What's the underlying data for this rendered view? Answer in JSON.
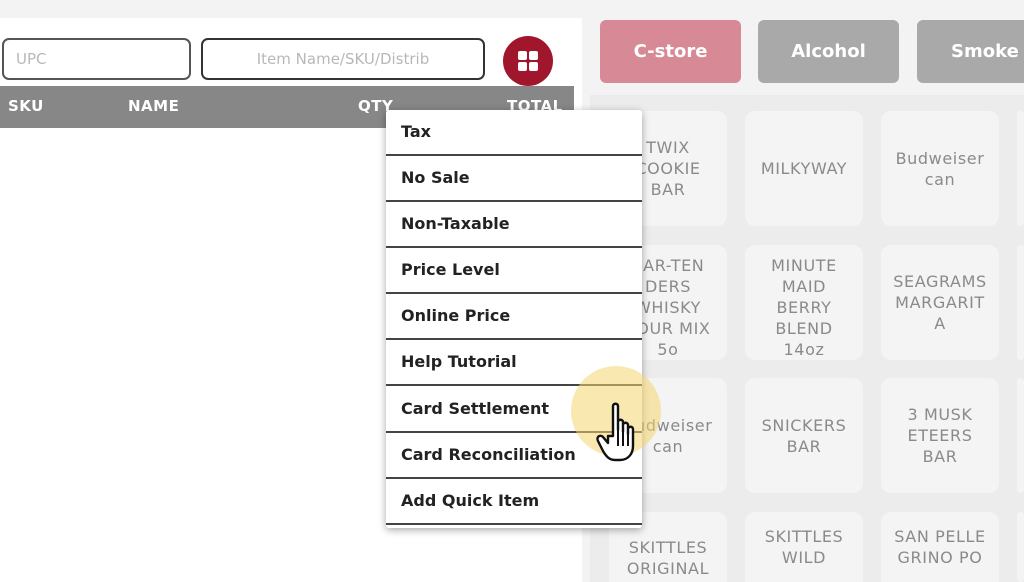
{
  "search": {
    "upc_placeholder": "UPC",
    "item_placeholder": "Item Name/SKU/Distrib"
  },
  "toolbar": {
    "grid_icon": "grid-icon",
    "grid_color": "#a0162c"
  },
  "table": {
    "columns": [
      "SKU",
      "NAME",
      "QTY",
      "TOTAL"
    ]
  },
  "categories": [
    {
      "label": "C-store",
      "color": "#d78a96"
    },
    {
      "label": "Alcohol",
      "color": "#a9a9a9"
    },
    {
      "label": "Smoke",
      "color": "#a9a9a9"
    }
  ],
  "products": [
    "TWIX\nCOOKIE\nBAR",
    "MILKYWAY",
    "Budweiser\ncan",
    "BAR-TEN\nDERS\nWHISKY\nSOUR MIX\n5o",
    "MINUTE\nMAID\nBERRY\nBLEND\n14oz",
    "SEAGRAMS\nMARGARIT\nA",
    "Budweiser\ncan",
    "SNICKERS\nBAR",
    "3 MUSK\nETEERS\nBAR",
    "SKITTLES\nORIGINAL",
    "SKITTLES\nWILD",
    "SAN PELLE\nGRINO PO"
  ],
  "menu": {
    "items": [
      "Tax",
      "No Sale",
      "Non-Taxable",
      "Price Level",
      "Online Price",
      "Help Tutorial",
      "Card Settlement",
      "Card Reconciliation",
      "Add Quick Item"
    ]
  },
  "cursor": {
    "icon": "hand-pointer-icon",
    "highlight_color": "#f4d66e"
  }
}
